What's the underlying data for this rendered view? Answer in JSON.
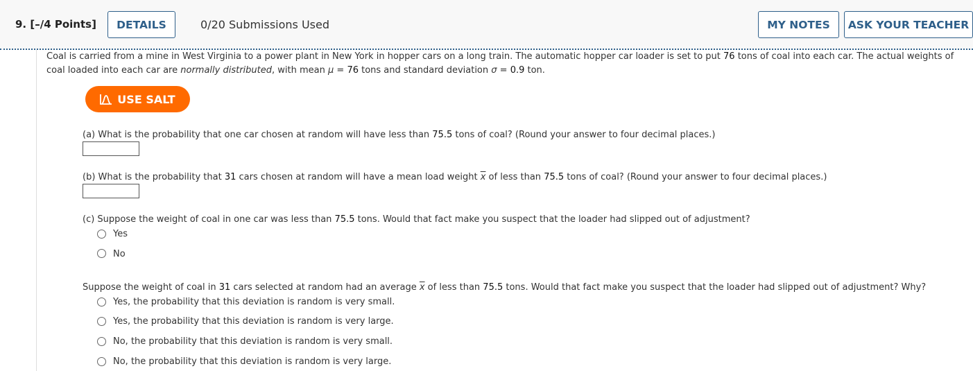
{
  "header": {
    "question_number": "9.",
    "points": "[–/4 Points]",
    "details_label": "DETAILS",
    "submissions": "0/20 Submissions Used",
    "my_notes_label": "MY NOTES",
    "ask_teacher_label": "ASK YOUR TEACHER"
  },
  "problem": {
    "intro_line1_pre": "Coal is carried from a mine in West Virginia to a power plant in New York in hopper cars on a long train. The automatic hopper car loader is set to put ",
    "intro_line1_num": "76",
    "intro_line1_post": " tons of coal into each car. The actual weights of",
    "intro_line2_pre": "coal loaded into each car are ",
    "intro_line2_em": "normally distributed",
    "intro_line2_mid": ", with mean ",
    "mu_symbol": "μ",
    "intro_line2_eq1": " = ",
    "mean_value": "76",
    "intro_line2_mid2": " tons and standard deviation ",
    "sigma_symbol": "σ",
    "intro_line2_eq2": " = ",
    "sd_value": "0.9",
    "intro_line2_post": " ton."
  },
  "salt_button_label": "USE SALT",
  "part_a": {
    "pre": "(a) What is the probability that one car chosen at random will have less than ",
    "num": "75.5",
    "post": " tons of coal? (Round your answer to four decimal places.)",
    "answer_value": ""
  },
  "part_b": {
    "pre": "(b) What is the probability that ",
    "n": "31",
    "mid": " cars chosen at random will have a mean load weight ",
    "xbar": "x",
    "mid2": " of less than ",
    "num": "75.5",
    "post": " tons of coal? (Round your answer to four decimal places.)",
    "answer_value": ""
  },
  "part_c": {
    "pre": "(c) Suppose the weight of coal in one car was less than ",
    "num": "75.5",
    "post": " tons. Would that fact make you suspect that the loader had slipped out of adjustment?",
    "options": [
      "Yes",
      "No"
    ]
  },
  "part_d": {
    "pre": "Suppose the weight of coal in ",
    "n": "31",
    "mid": " cars selected at random had an average ",
    "xbar": "x",
    "mid2": " of less than ",
    "num": "75.5",
    "post": " tons. Would that fact make you suspect that the loader had slipped out of adjustment? Why?",
    "options": [
      "Yes, the probability that this deviation is random is very small.",
      "Yes, the probability that this deviation is random is very large.",
      "No, the probability that this deviation is random is very small.",
      "No, the probability that this deviation is random is very large."
    ]
  },
  "colors": {
    "accent": "#2e5f8a",
    "salt": "#ff6a00"
  },
  "icons": {
    "salt": "salt-chart-icon"
  }
}
